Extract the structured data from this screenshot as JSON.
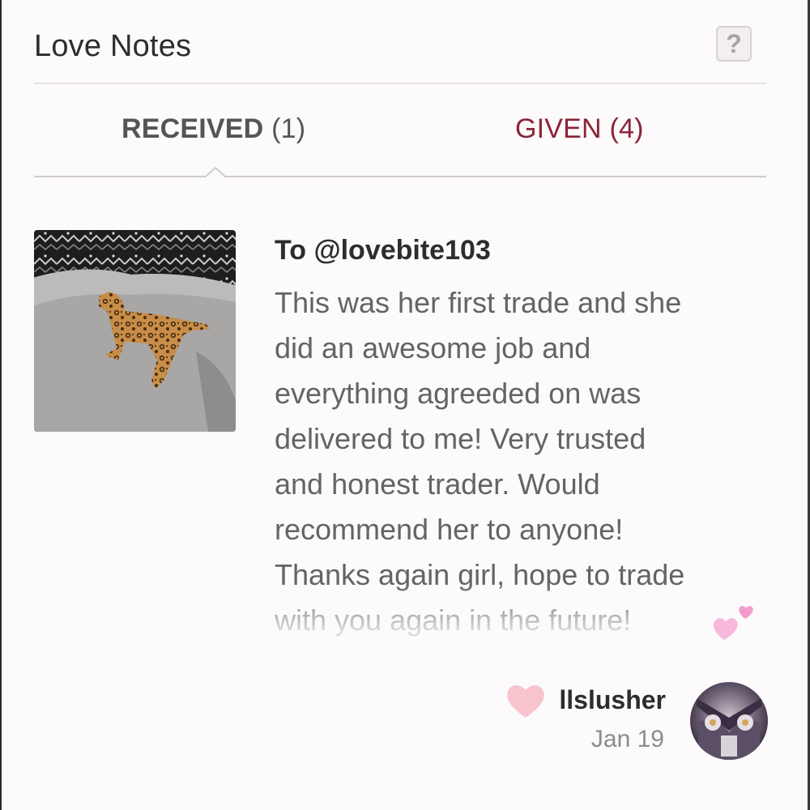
{
  "header": {
    "title": "Love Notes",
    "help_label": "?"
  },
  "tabs": [
    {
      "label": "RECEIVED",
      "count": "(1)",
      "active": true
    },
    {
      "label": "GIVEN",
      "count": "(4)",
      "active": false
    }
  ],
  "note": {
    "to": "To @lovebite103",
    "text": "This was her first trade and she\ndid an awesome job and\neverything agreeded on was\ndelivered to me! Very trusted\nand honest trader. Would\nrecommend her to anyone!\nThanks again girl, hope to trade\nwith you again in the future!",
    "emoji": "two-hearts-emoji"
  },
  "author": {
    "name": "llslusher",
    "date": "Jan 19"
  },
  "colors": {
    "accent": "#8a2436",
    "heart": "#f7c3cd",
    "background": "#fcfafb"
  },
  "icons": [
    "help-icon",
    "tab-indicator-caret-icon",
    "heart-icon",
    "two-hearts-icon"
  ]
}
